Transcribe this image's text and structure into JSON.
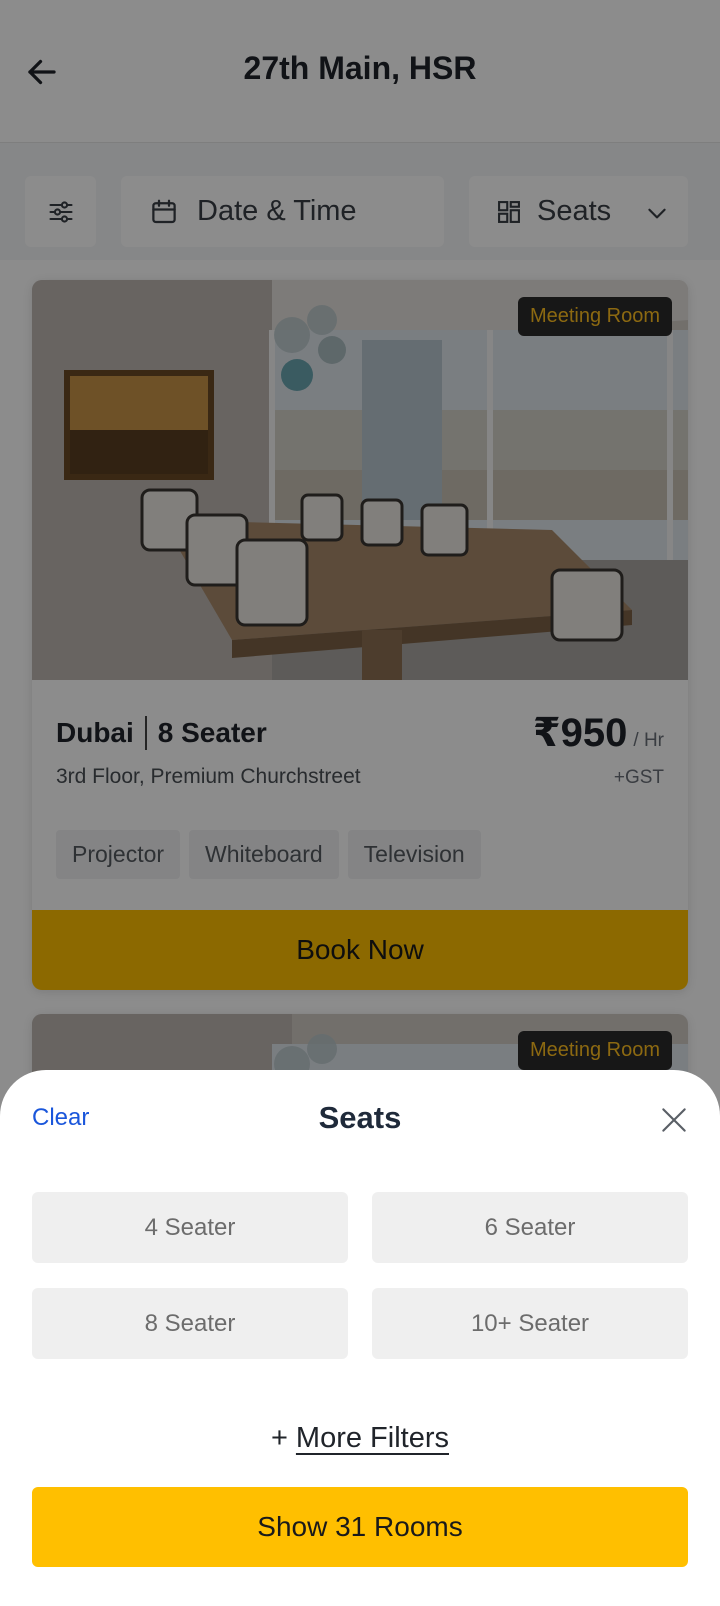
{
  "header": {
    "title": "27th Main, HSR",
    "back_icon": "arrow-left-icon"
  },
  "filters": {
    "settings_icon": "sliders-icon",
    "date_label": "Date & Time",
    "date_icon": "calendar-icon",
    "seats_label": "Seats",
    "seats_icon": "grid-icon",
    "seats_chevron_icon": "chevron-down-icon"
  },
  "cards": [
    {
      "badge": "Meeting Room",
      "name": "Dubai",
      "capacity": "8 Seater",
      "address": "3rd Floor, Premium Churchstreet",
      "price": "₹950",
      "price_unit": "/ Hr",
      "tax_note": "+GST",
      "tags": [
        "Projector",
        "Whiteboard",
        "Television"
      ],
      "book_label": "Book Now"
    },
    {
      "badge": "Meeting Room"
    }
  ],
  "sheet": {
    "clear_label": "Clear",
    "title": "Seats",
    "close_icon": "close-icon",
    "options": [
      "4 Seater",
      "6 Seater",
      "8 Seater",
      "10+ Seater"
    ],
    "more_filters_prefix": "+",
    "more_filters_label": "More Filters",
    "show_button": "Show 31 Rooms"
  },
  "colors": {
    "accent": "#ffbf00",
    "link": "#1a56db",
    "badge_text": "#ffbf1f"
  }
}
